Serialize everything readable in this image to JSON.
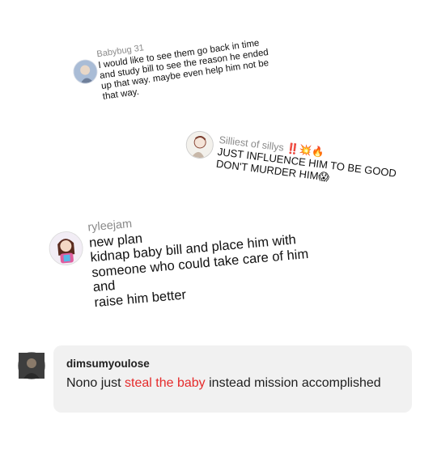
{
  "comments": [
    {
      "username": "Babybug 31",
      "text": "I would like to see them go back in time and study bill to see the reason he ended up that way. maybe even help him not be that way."
    },
    {
      "username": "Silliest of sillys",
      "username_emoji": "‼️💥🔥",
      "text": "JUST INFLUENCE HIM TO BE GOOD DON'T MURDER HIM",
      "text_emoji": "😱"
    },
    {
      "username": "ryleejam",
      "lines": [
        "new plan",
        "kidnap baby bill and place him with",
        "someone who could take care of him and",
        "raise him better"
      ]
    },
    {
      "username": "dimsumyoulose",
      "text_before": "Nono just ",
      "text_highlight": "steal the baby",
      "text_after": " instead mission accomplished",
      "highlight_color": "#e52b2b"
    }
  ]
}
